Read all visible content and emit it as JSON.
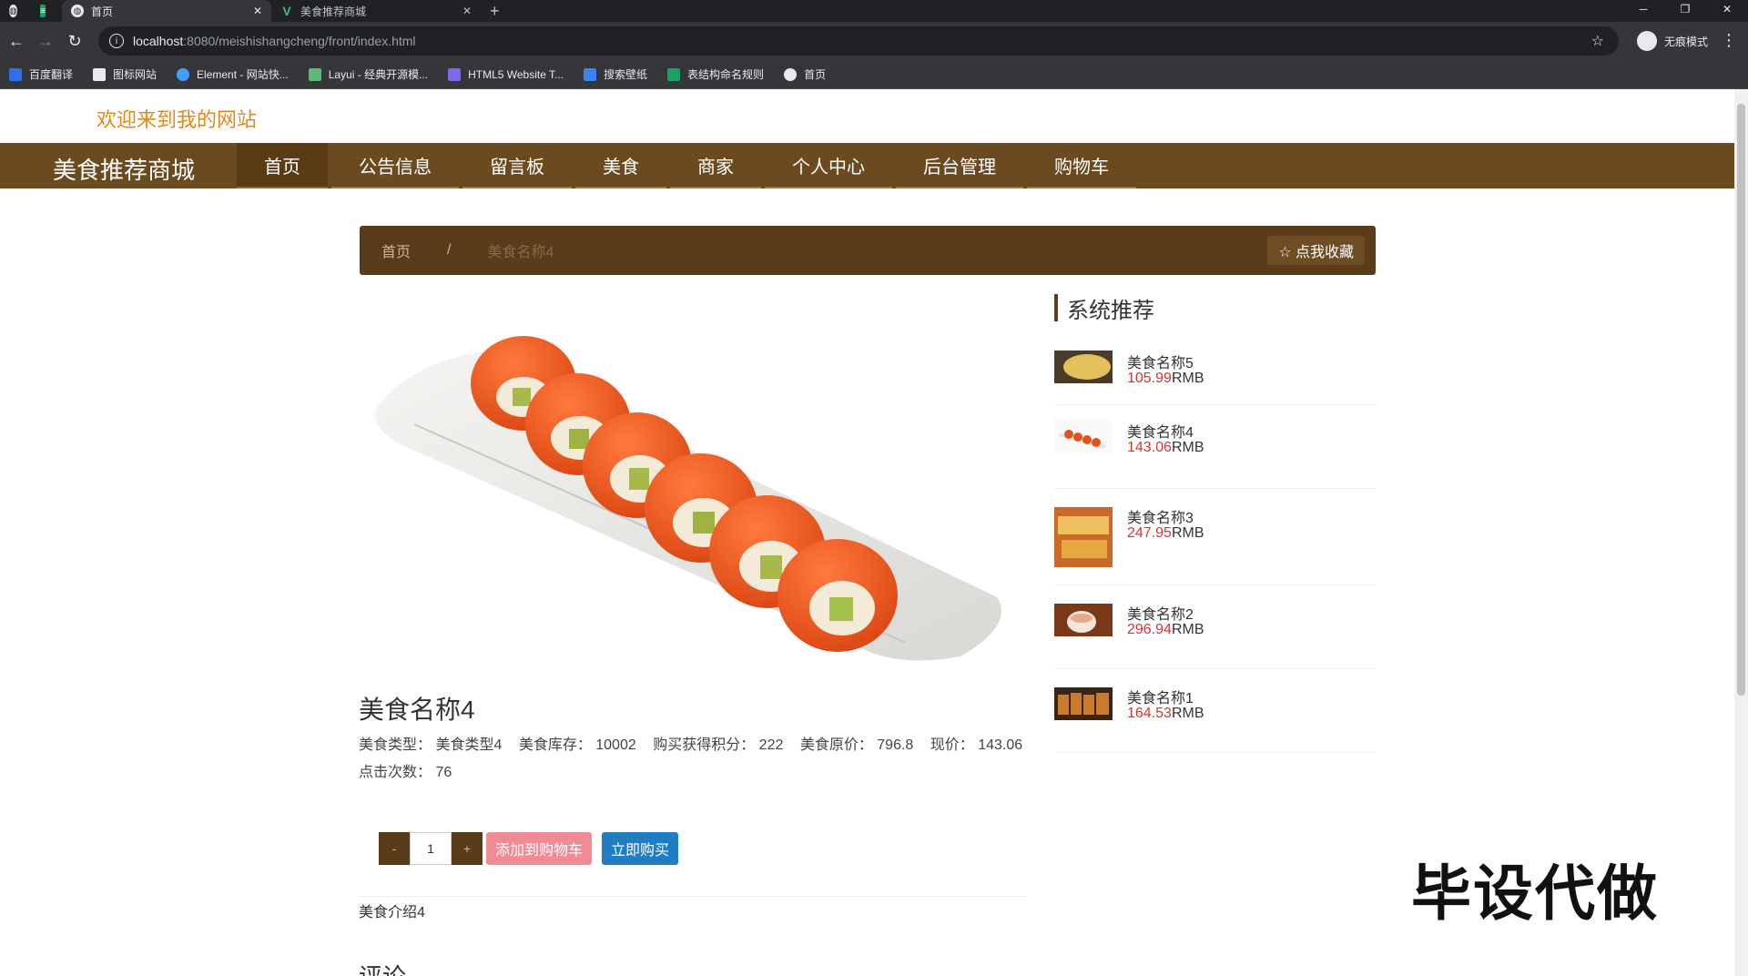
{
  "browser": {
    "tabs": [
      {
        "label": "首页",
        "active": true
      },
      {
        "label": "美食推荐商城",
        "active": false
      }
    ],
    "url_host": "localhost",
    "url_path": ":8080/meishishangcheng/front/index.html",
    "profile_label": "无痕模式",
    "bookmarks": [
      "百度翻译",
      "图标网站",
      "Element - 网站快...",
      "Layui - 经典开源模...",
      "HTML5 Website T...",
      "搜索壁纸",
      "表结构命名规则",
      "首页"
    ]
  },
  "header": {
    "welcome": "欢迎来到我的网站",
    "brand": "美食推荐商城",
    "nav": [
      "首页",
      "公告信息",
      "留言板",
      "美食",
      "商家",
      "个人中心",
      "后台管理",
      "购物车"
    ]
  },
  "breadcrumb": {
    "home": "首页",
    "separator": "/",
    "current": "美食名称4",
    "favorite_button": "☆ 点我收藏"
  },
  "product": {
    "title": "美食名称4",
    "meta_line1": [
      "美食类型：  美食类型4",
      "美食库存：  10002",
      "购买获得积分：  222",
      "美食原价：  796.8",
      "现价：  143.06"
    ],
    "meta_line2": "点击次数：  76",
    "qty_minus": "-",
    "qty_value": "1",
    "qty_plus": "+",
    "add_to_cart": "添加到购物车",
    "buy_now": "立即购买",
    "intro": "美食介绍4",
    "next_section": "评论"
  },
  "sidebar": {
    "heading": "系统推荐",
    "items": [
      {
        "name": "美食名称5",
        "price": "105.99",
        "unit": "RMB"
      },
      {
        "name": "美食名称4",
        "price": "143.06",
        "unit": "RMB"
      },
      {
        "name": "美食名称3",
        "price": "247.95",
        "unit": "RMB"
      },
      {
        "name": "美食名称2",
        "price": "296.94",
        "unit": "RMB"
      },
      {
        "name": "美食名称1",
        "price": "164.53",
        "unit": "RMB"
      }
    ]
  },
  "watermark": "毕设代做",
  "colors": {
    "accent_brown": "#6b4a1f",
    "welcome_orange": "#e08a1e",
    "price_red": "#e03030",
    "cart_pink": "#f08a94",
    "buy_blue": "#1f7ec1"
  }
}
